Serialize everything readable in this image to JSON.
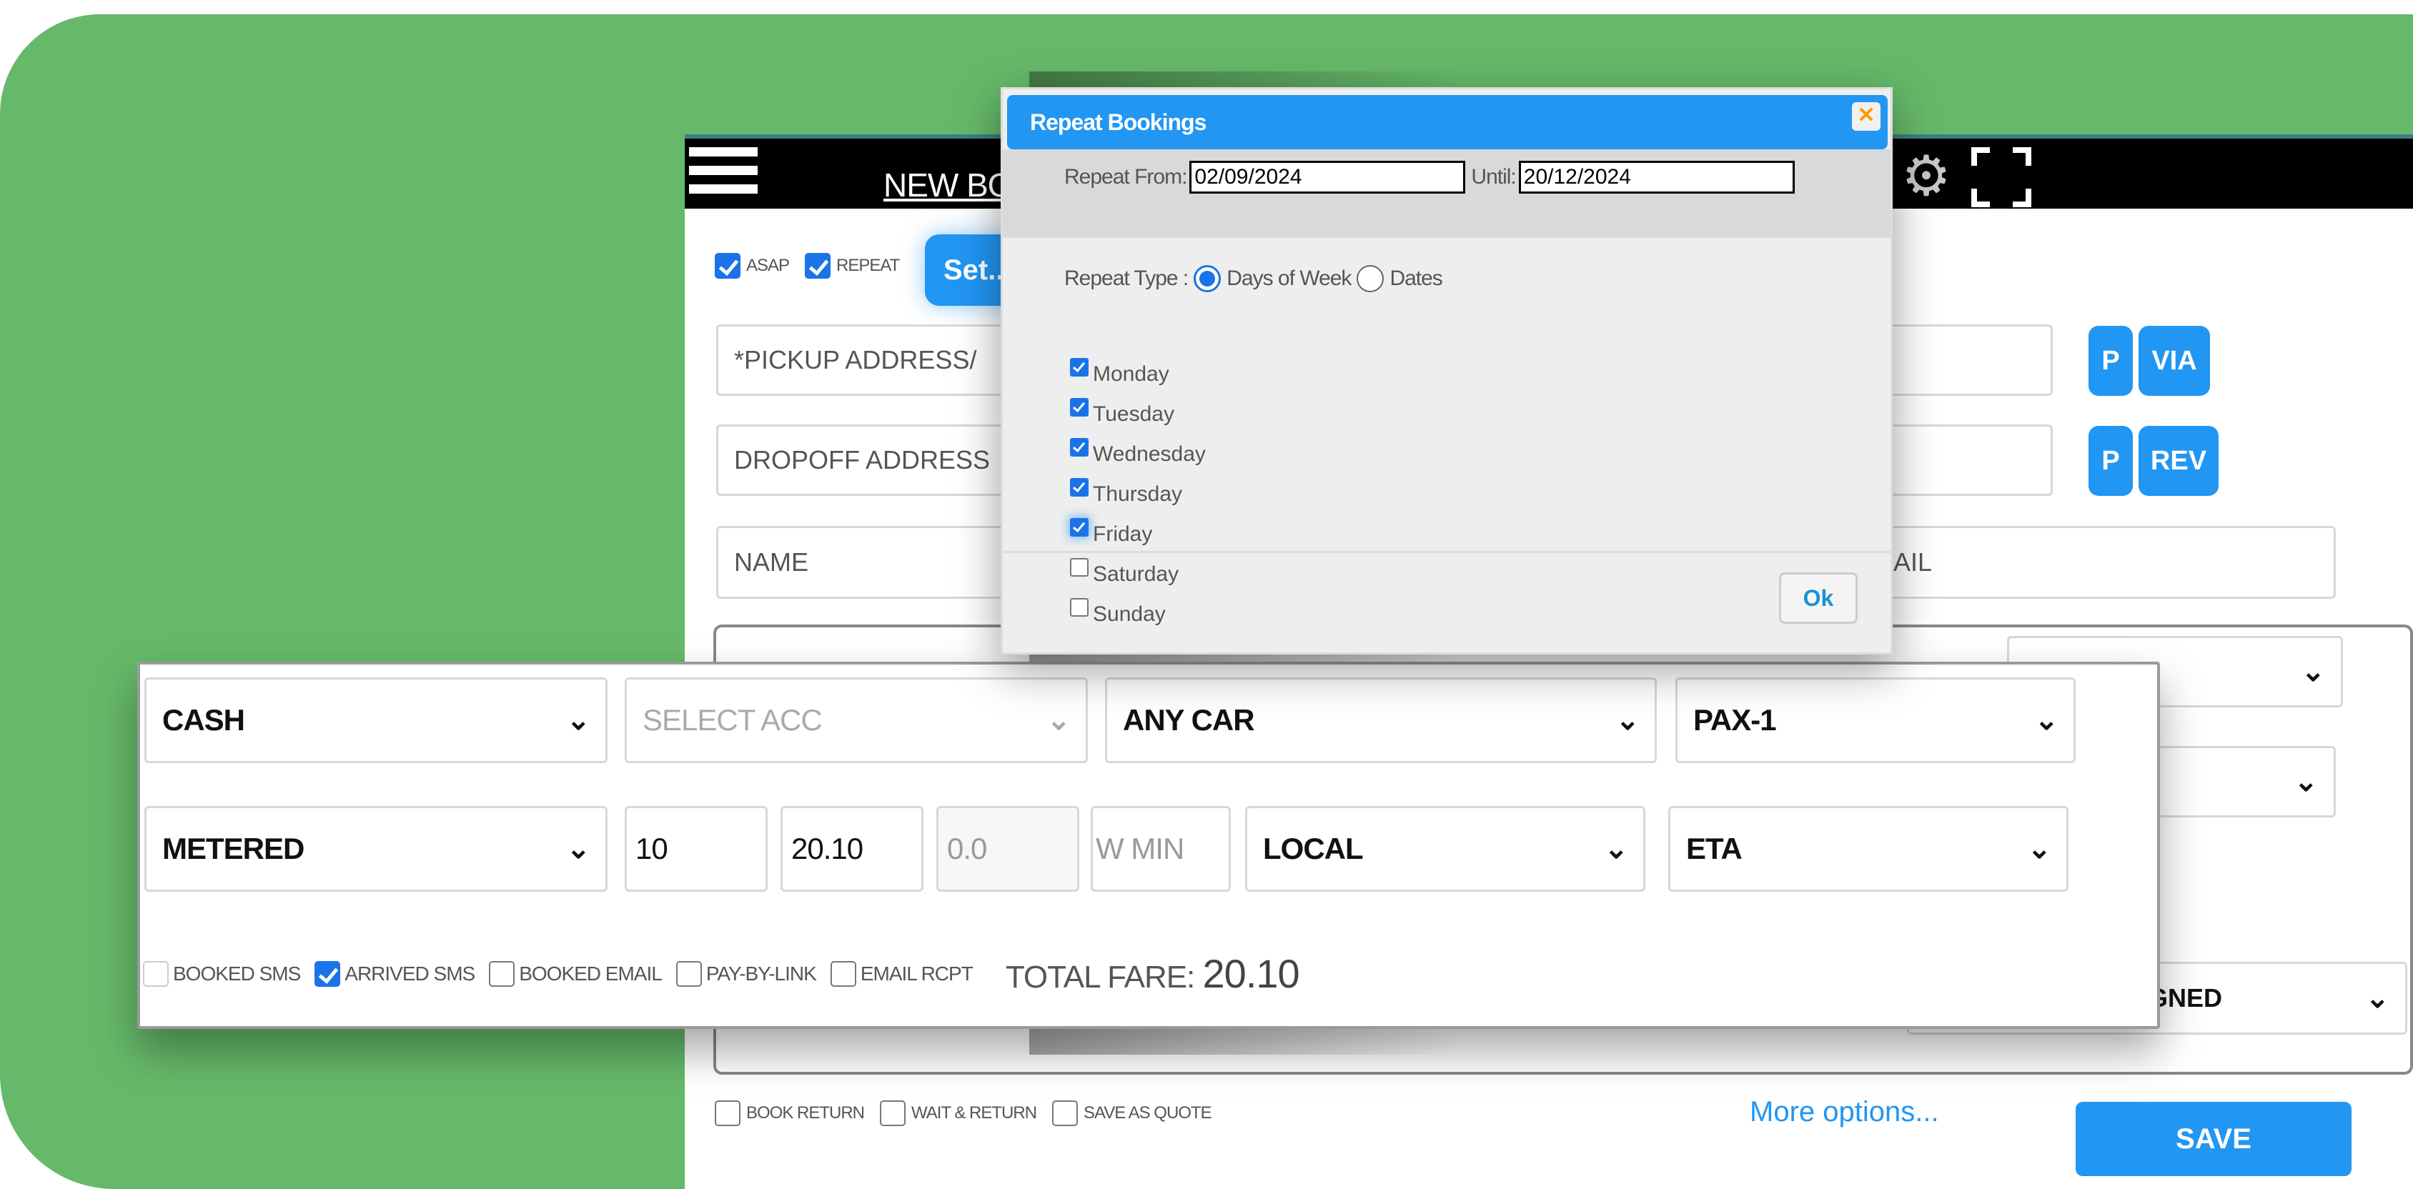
{
  "header": {
    "title": "NEW BOOKING",
    "menu_icon": "hamburger-icon",
    "settings_icon": "gear-icon",
    "fullscreen_icon": "fullscreen-icon"
  },
  "options": {
    "asap": {
      "label": "ASAP",
      "checked": true
    },
    "repeat": {
      "label": "REPEAT",
      "checked": true
    },
    "set_button": "Set..."
  },
  "address": {
    "pickup_placeholder": "*PICKUP ADDRESS/",
    "dropoff_placeholder": "DROPOFF ADDRESS",
    "name_placeholder": "NAME",
    "email_placeholder": "EMAIL",
    "pickup_buttons": [
      "P",
      "VIA"
    ],
    "dropoff_buttons": [
      "P",
      "REV"
    ]
  },
  "hidden_status_select": "SIGNED",
  "payment": {
    "payment_type": "CASH",
    "account": "SELECT ACC",
    "car_type": "ANY CAR",
    "passengers": "PAX-1",
    "fare_type": "METERED",
    "field_1": "10",
    "fare": "20.10",
    "extra": "0.0",
    "wait_min_placeholder": "W MIN",
    "zone": "LOCAL",
    "time_type": "ETA"
  },
  "notifications": [
    {
      "label": "BOOKED SMS",
      "checked": false,
      "disabled": true
    },
    {
      "label": "ARRIVED SMS",
      "checked": true
    },
    {
      "label": "BOOKED EMAIL",
      "checked": false
    },
    {
      "label": "PAY-BY-LINK",
      "checked": false
    },
    {
      "label": "EMAIL RCPT",
      "checked": false
    }
  ],
  "total_fare": {
    "label": "TOTAL FARE:",
    "value": "20.10"
  },
  "bottom": {
    "book_return": "BOOK RETURN",
    "wait_return": "WAIT & RETURN",
    "save_as_quote": "SAVE AS QUOTE",
    "more_options": "More options...",
    "save": "SAVE"
  },
  "dialog": {
    "title": "Repeat Bookings",
    "close_icon": "close-icon",
    "repeat_from_label": "Repeat From:",
    "repeat_from_value": "02/09/2024",
    "until_label": "Until:",
    "until_value": "20/12/2024",
    "repeat_type_label": "Repeat Type :",
    "repeat_type_options": [
      "Days of Week",
      "Dates"
    ],
    "repeat_type_selected": "Days of Week",
    "days": [
      {
        "label": "Monday",
        "checked": true
      },
      {
        "label": "Tuesday",
        "checked": true
      },
      {
        "label": "Wednesday",
        "checked": true
      },
      {
        "label": "Thursday",
        "checked": true
      },
      {
        "label": "Friday",
        "checked": true
      },
      {
        "label": "Saturday",
        "checked": false
      },
      {
        "label": "Sunday",
        "checked": false
      }
    ],
    "ok_button": "Ok"
  },
  "colors": {
    "background_green": "#66b96a",
    "accent_blue": "#2196f3",
    "header_black": "#000000",
    "close_orange": "#ff9800"
  }
}
